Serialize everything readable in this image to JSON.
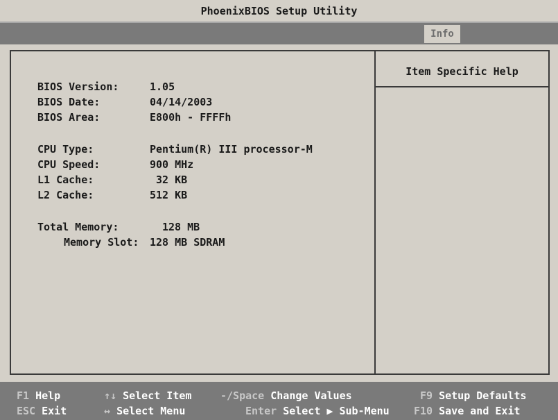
{
  "title": "PhoenixBIOS Setup Utility",
  "menu": {
    "tabs": [
      {
        "label": "Info",
        "selected": true
      }
    ]
  },
  "info": {
    "bios_version": {
      "label": "BIOS Version:",
      "value": "1.05"
    },
    "bios_date": {
      "label": "BIOS Date:",
      "value": "04/14/2003"
    },
    "bios_area": {
      "label": "BIOS Area:",
      "value": "E800h - FFFFh"
    },
    "cpu_type": {
      "label": "CPU Type:",
      "value": "Pentium(R) III processor-M"
    },
    "cpu_speed": {
      "label": "CPU Speed:",
      "value": "900 MHz"
    },
    "l1_cache": {
      "label": "L1 Cache:",
      "value": "32 KB"
    },
    "l2_cache": {
      "label": "L2 Cache:",
      "value": "512 KB"
    },
    "total_memory": {
      "label": "Total Memory:",
      "value": "128 MB"
    },
    "memory_slot": {
      "label": "Memory Slot:",
      "value": "128 MB SDRAM"
    }
  },
  "help_panel": {
    "title": "Item Specific Help"
  },
  "footer": {
    "f1": {
      "key": "F1",
      "desc": "Help"
    },
    "select_item": {
      "key": "↑↓",
      "desc": "Select Item"
    },
    "change_values": {
      "key": "-/Space",
      "desc": "Change Values"
    },
    "f9": {
      "key": "F9",
      "desc": "Setup Defaults"
    },
    "esc": {
      "key": "ESC",
      "desc": "Exit"
    },
    "select_menu": {
      "key": "↔",
      "desc": "Select Menu"
    },
    "enter": {
      "key": "Enter",
      "desc": "Select ▶ Sub-Menu"
    },
    "f10": {
      "key": "F10",
      "desc": "Save and Exit"
    }
  },
  "colors": {
    "background": "#d4d0c8",
    "bar": "#7a7a7a",
    "key_text": "#c8c8c8",
    "footer_text": "#ffffff"
  }
}
